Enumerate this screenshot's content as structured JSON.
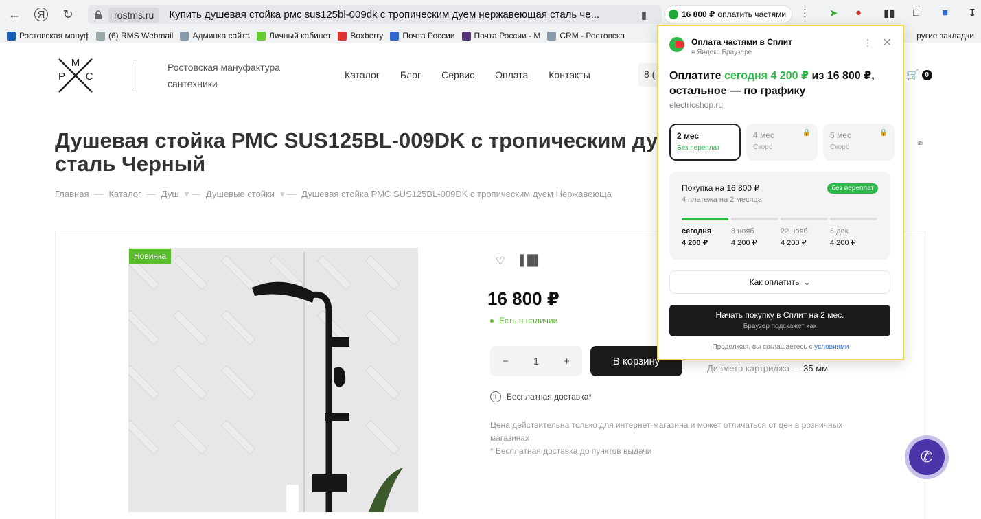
{
  "browser": {
    "domain": "rostms.ru",
    "tab_title": "Купить душевая стойка рмс sus125bl-009dk с тропическим дуем нержавеющая сталь че...",
    "split_pill": {
      "amount": "16 800 ₽",
      "label": "оплатить частями"
    },
    "bookmarks": [
      {
        "label": "Ростовская мануф",
        "icon": "rms-favicon"
      },
      {
        "label": "(6) RMS Webmail",
        "icon": "webmail-icon"
      },
      {
        "label": "Админка сайта",
        "icon": "admin-icon"
      },
      {
        "label": "Личный кабинет",
        "icon": "cabinet-icon"
      },
      {
        "label": "Boxberry",
        "icon": "boxberry-icon"
      },
      {
        "label": "Почта России",
        "icon": "post-icon"
      },
      {
        "label": "Почта России - М",
        "icon": "post-icon"
      },
      {
        "label": "CRM - Ростовска",
        "icon": "crm-icon"
      }
    ],
    "other_bookmarks": "ругие закладки"
  },
  "site": {
    "logo_letters": {
      "m": "M",
      "p": "P",
      "c": "C"
    },
    "company": {
      "line1": "Ростовская мануфактура",
      "line2": "сантехники"
    },
    "menu": [
      "Каталог",
      "Блог",
      "Сервис",
      "Оплата",
      "Контакты"
    ],
    "phone_stub": "8 (",
    "cart_count": "0"
  },
  "product": {
    "title_line1": "Душевая стойка РМС SUS125BL-009DK с тропическим ду",
    "title_line2": "сталь Черный",
    "breadcrumbs": [
      "Главная",
      "Каталог",
      "Душ",
      "Душевые стойки",
      "Душевая стойка РМС SUS125BL-009DK с тропическим дуем Нержавеюща"
    ],
    "badge": "Новинка",
    "price": "16 800 ₽",
    "stock": "Есть в наличии",
    "qty": "1",
    "to_cart": "В корзину",
    "spec_label": "Диаметр картриджа",
    "spec_value": "35 мм",
    "delivery": "Бесплатная доставка*",
    "note1": "Цена действительна только для интернет-магазина и может отличаться от цен в розничных магазинах",
    "note2": "* Бесплатная доставка до пунктов выдачи"
  },
  "split_popup": {
    "title": "Оплата частями в Сплит",
    "subtitle": "в Яндекс Браузере",
    "main_pre": "Оплатите ",
    "main_green": "сегодня 4 200 ₽",
    "main_post": " из 16 800 ₽, остальное — по графику",
    "shop": "electricshop.ru",
    "terms": [
      {
        "label": "2 мес",
        "sub": "Без переплат",
        "selected": true
      },
      {
        "label": "4 мес",
        "sub": "Скоро",
        "selected": false
      },
      {
        "label": "6 мес",
        "sub": "Скоро",
        "selected": false
      }
    ],
    "schedule": {
      "title": "Покупка на 16 800 ₽",
      "subtitle": "4 платежа на 2 месяца",
      "badge": "без переплат",
      "payments": [
        {
          "date": "сегодня",
          "amount": "4 200 ₽"
        },
        {
          "date": "8 нояб",
          "amount": "4 200 ₽"
        },
        {
          "date": "22 нояб",
          "amount": "4 200 ₽"
        },
        {
          "date": "6 дек",
          "amount": "4 200 ₽"
        }
      ]
    },
    "how_to_pay": "Как оплатить",
    "start_button": "Начать покупку в Сплит на 2 мес.",
    "start_hint": "Браузер подскажет как",
    "agree_pre": "Продолжая, вы соглашаетесь с ",
    "agree_link": "условиями"
  },
  "colors": {
    "green": "#2db84a",
    "accent_yellow": "#f0d84a",
    "call_purple": "#4b34a8"
  }
}
